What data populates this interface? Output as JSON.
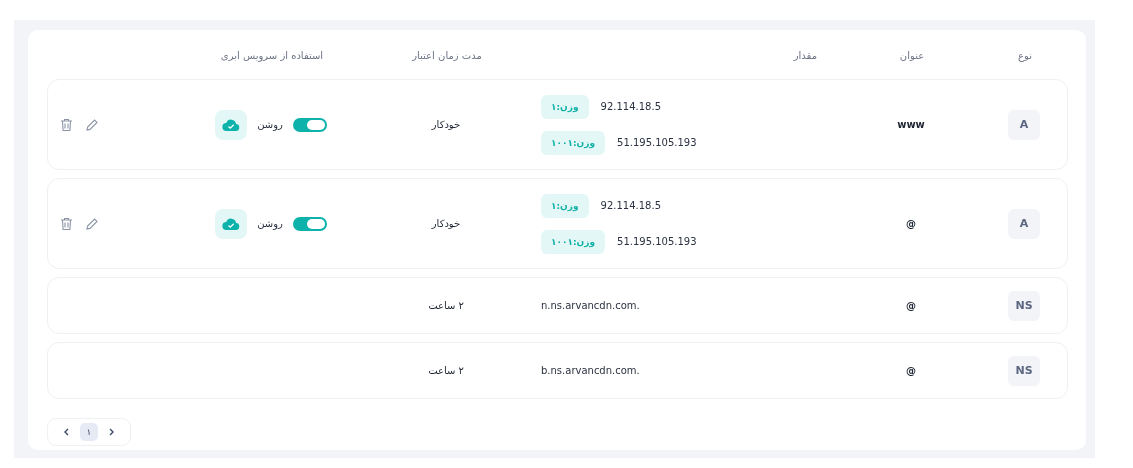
{
  "table": {
    "columns": [
      "نوع",
      "عنوان",
      "مقدار",
      "مدت زمان اعتبار",
      "استفاده از سرویس ابری"
    ],
    "rows": [
      {
        "type": "A",
        "title": "www",
        "values": [
          {
            "address": "92.114.18.5",
            "weight": "وزن:۱"
          },
          {
            "address": "51.195.105.193",
            "weight": "وزن:۱۰۰۱"
          }
        ],
        "ttl": "خودکار",
        "cloud": {
          "on": true,
          "label": "روشن"
        }
      },
      {
        "type": "A",
        "title": "@",
        "values": [
          {
            "address": "92.114.18.5",
            "weight": "وزن:۱"
          },
          {
            "address": "51.195.105.193",
            "weight": "وزن:۱۰۰۱"
          }
        ],
        "ttl": "خودکار",
        "cloud": {
          "on": true,
          "label": "روشن"
        }
      },
      {
        "type": "NS",
        "title": "@",
        "values": [
          {
            "address": "n.ns.arvancdn.com."
          }
        ],
        "ttl": "۲ ساعت"
      },
      {
        "type": "NS",
        "title": "@",
        "values": [
          {
            "address": "b.ns.arvancdn.com."
          }
        ],
        "ttl": "۲ ساعت"
      }
    ]
  },
  "pagination": {
    "pages": [
      {
        "label": "۱",
        "selected": true
      }
    ]
  }
}
